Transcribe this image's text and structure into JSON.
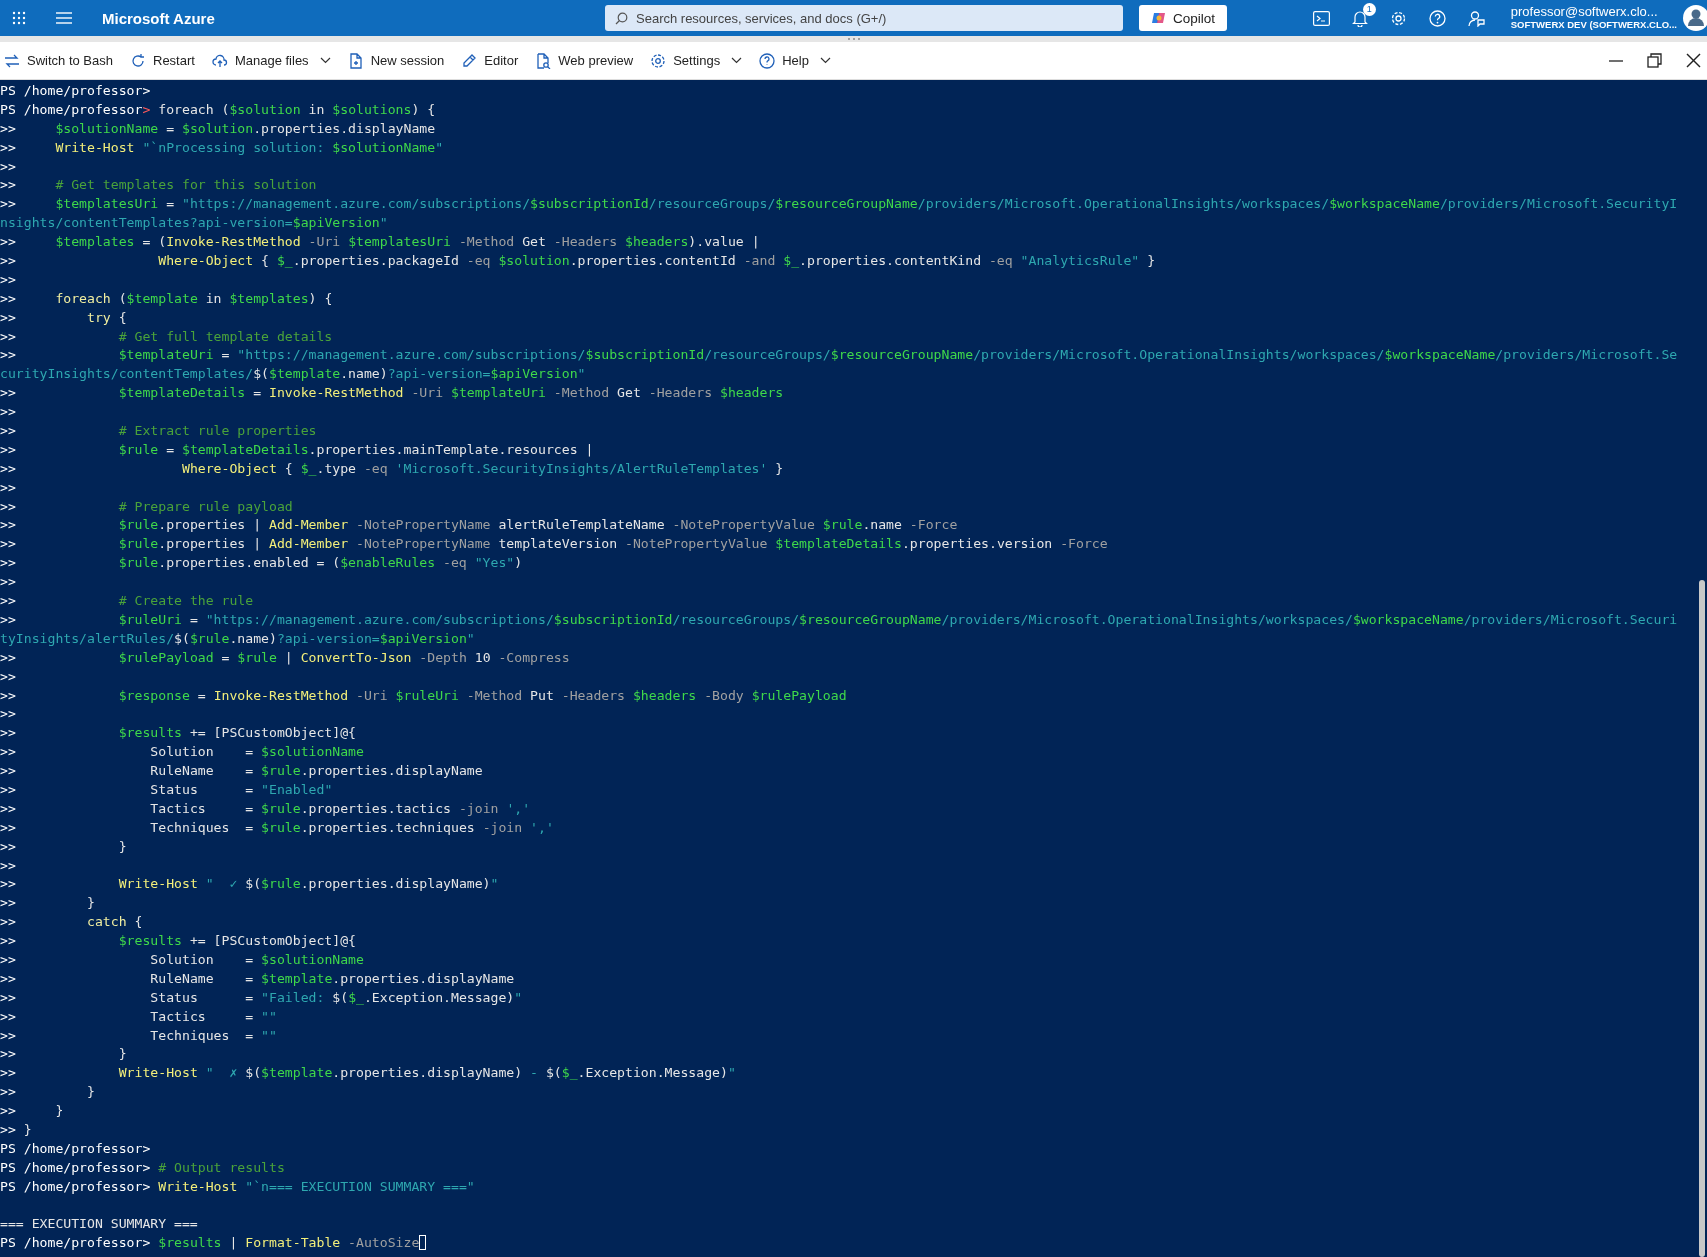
{
  "top_bar": {
    "brand": "Microsoft Azure",
    "search": {
      "placeholder": "Search resources, services, and docs (G+/)"
    },
    "copilot": "Copilot",
    "notification_count": "1",
    "user": {
      "email": "professor@softwerx.clo...",
      "directory": "SOFTWERX DEV (SOFTWERX.CLO..."
    }
  },
  "toolbar": {
    "items": [
      {
        "kind": "switch",
        "label": "Switch to Bash",
        "dropdown": false
      },
      {
        "kind": "restart",
        "label": "Restart",
        "dropdown": false
      },
      {
        "kind": "files",
        "label": "Manage files",
        "dropdown": true
      },
      {
        "kind": "session",
        "label": "New session",
        "dropdown": false
      },
      {
        "kind": "editor",
        "label": "Editor",
        "dropdown": false
      },
      {
        "kind": "preview",
        "label": "Web preview",
        "dropdown": false
      },
      {
        "kind": "settings",
        "label": "Settings",
        "dropdown": true
      },
      {
        "kind": "help",
        "label": "Help",
        "dropdown": true
      }
    ]
  },
  "terminal": {
    "lines": [
      {
        "segments": [
          {
            "kind": "prompt",
            "text": "PS /home/professor>"
          }
        ]
      },
      {
        "segments": [
          {
            "kind": "prompt",
            "text": "PS /home/professor"
          },
          {
            "kind": "error",
            "text": ">"
          },
          {
            "kind": "plain",
            "text": " foreach ("
          },
          {
            "kind": "var",
            "text": "$solution"
          },
          {
            "kind": "plain",
            "text": " in "
          },
          {
            "kind": "var",
            "text": "$solutions"
          },
          {
            "kind": "plain",
            "text": ") {"
          }
        ]
      },
      {
        "segments": [
          {
            "kind": "prompt",
            "text": ">>"
          },
          {
            "kind": "var",
            "text": "     $solutionName"
          },
          {
            "kind": "plain",
            "text": " = "
          },
          {
            "kind": "var",
            "text": "$solution"
          },
          {
            "kind": "plain",
            "text": ".properties.displayName"
          }
        ]
      },
      {
        "segments": [
          {
            "kind": "prompt",
            "text": ">>"
          },
          {
            "kind": "cmd",
            "text": "     Write-Host"
          },
          {
            "kind": "str",
            "text": " \"`nProcessing solution: "
          },
          {
            "kind": "var",
            "text": "$solutionName"
          },
          {
            "kind": "str",
            "text": "\""
          }
        ]
      },
      {
        "segments": [
          {
            "kind": "prompt",
            "text": ">>"
          }
        ]
      },
      {
        "segments": [
          {
            "kind": "prompt",
            "text": ">>"
          },
          {
            "kind": "comment",
            "text": "     # Get templates for this solution"
          }
        ]
      },
      {
        "segments": [
          {
            "kind": "prompt",
            "text": ">>"
          },
          {
            "kind": "var",
            "text": "     $templatesUri"
          },
          {
            "kind": "plain",
            "text": " = "
          },
          {
            "kind": "str",
            "text": "\"https://management.azure.com/subscriptions/"
          },
          {
            "kind": "var",
            "text": "$subscriptionId"
          },
          {
            "kind": "str",
            "text": "/resourceGroups/"
          },
          {
            "kind": "var",
            "text": "$resourceGroupName"
          },
          {
            "kind": "str",
            "text": "/providers/Microsoft.OperationalInsights/workspaces/"
          },
          {
            "kind": "var",
            "text": "$workspaceName"
          },
          {
            "kind": "str",
            "text": "/providers/Microsoft.SecurityI"
          }
        ]
      },
      {
        "segments": [
          {
            "kind": "str",
            "text": "nsights/contentTemplates?api-version="
          },
          {
            "kind": "var",
            "text": "$apiVersion"
          },
          {
            "kind": "str",
            "text": "\""
          }
        ]
      },
      {
        "segments": [
          {
            "kind": "prompt",
            "text": ">>"
          },
          {
            "kind": "var",
            "text": "     $templates"
          },
          {
            "kind": "plain",
            "text": " = ("
          },
          {
            "kind": "cmd",
            "text": "Invoke-RestMethod"
          },
          {
            "kind": "param",
            "text": " -Uri "
          },
          {
            "kind": "var",
            "text": "$templatesUri"
          },
          {
            "kind": "param",
            "text": " -Method "
          },
          {
            "kind": "plain",
            "text": "Get"
          },
          {
            "kind": "param",
            "text": " -Headers "
          },
          {
            "kind": "var",
            "text": "$headers"
          },
          {
            "kind": "plain",
            "text": ").value |"
          }
        ]
      },
      {
        "segments": [
          {
            "kind": "prompt",
            "text": ">>"
          },
          {
            "kind": "cmd",
            "text": "                  Where-Object"
          },
          {
            "kind": "plain",
            "text": " { "
          },
          {
            "kind": "var",
            "text": "$_"
          },
          {
            "kind": "plain",
            "text": ".properties.packageId"
          },
          {
            "kind": "param",
            "text": " -eq "
          },
          {
            "kind": "var",
            "text": "$solution"
          },
          {
            "kind": "plain",
            "text": ".properties.contentId"
          },
          {
            "kind": "param",
            "text": " -and "
          },
          {
            "kind": "var",
            "text": "$_"
          },
          {
            "kind": "plain",
            "text": ".properties.contentKind"
          },
          {
            "kind": "param",
            "text": " -eq "
          },
          {
            "kind": "str",
            "text": "\"AnalyticsRule\""
          },
          {
            "kind": "plain",
            "text": " }"
          }
        ]
      },
      {
        "segments": [
          {
            "kind": "prompt",
            "text": ">>"
          }
        ]
      },
      {
        "segments": [
          {
            "kind": "prompt",
            "text": ">>"
          },
          {
            "kind": "kw",
            "text": "     foreach"
          },
          {
            "kind": "plain",
            "text": " ("
          },
          {
            "kind": "var",
            "text": "$template"
          },
          {
            "kind": "plain",
            "text": " in "
          },
          {
            "kind": "var",
            "text": "$templates"
          },
          {
            "kind": "plain",
            "text": ") {"
          }
        ]
      },
      {
        "segments": [
          {
            "kind": "prompt",
            "text": ">>"
          },
          {
            "kind": "kw",
            "text": "         try"
          },
          {
            "kind": "plain",
            "text": " {"
          }
        ]
      },
      {
        "segments": [
          {
            "kind": "prompt",
            "text": ">>"
          },
          {
            "kind": "comment",
            "text": "             # Get full template details"
          }
        ]
      },
      {
        "segments": [
          {
            "kind": "prompt",
            "text": ">>"
          },
          {
            "kind": "var",
            "text": "             $templateUri"
          },
          {
            "kind": "plain",
            "text": " = "
          },
          {
            "kind": "str",
            "text": "\"https://management.azure.com/subscriptions/"
          },
          {
            "kind": "var",
            "text": "$subscriptionId"
          },
          {
            "kind": "str",
            "text": "/resourceGroups/"
          },
          {
            "kind": "var",
            "text": "$resourceGroupName"
          },
          {
            "kind": "str",
            "text": "/providers/Microsoft.OperationalInsights/workspaces/"
          },
          {
            "kind": "var",
            "text": "$workspaceName"
          },
          {
            "kind": "str",
            "text": "/providers/Microsoft.Se"
          }
        ]
      },
      {
        "segments": [
          {
            "kind": "str",
            "text": "curityInsights/contentTemplates/"
          },
          {
            "kind": "plain",
            "text": "$("
          },
          {
            "kind": "var",
            "text": "$template"
          },
          {
            "kind": "plain",
            "text": ".name)"
          },
          {
            "kind": "str",
            "text": "?api-version="
          },
          {
            "kind": "var",
            "text": "$apiVersion"
          },
          {
            "kind": "str",
            "text": "\""
          }
        ]
      },
      {
        "segments": [
          {
            "kind": "prompt",
            "text": ">>"
          },
          {
            "kind": "var",
            "text": "             $templateDetails"
          },
          {
            "kind": "plain",
            "text": " = "
          },
          {
            "kind": "cmd",
            "text": "Invoke-RestMethod"
          },
          {
            "kind": "param",
            "text": " -Uri "
          },
          {
            "kind": "var",
            "text": "$templateUri"
          },
          {
            "kind": "param",
            "text": " -Method "
          },
          {
            "kind": "plain",
            "text": "Get"
          },
          {
            "kind": "param",
            "text": " -Headers "
          },
          {
            "kind": "var",
            "text": "$headers"
          }
        ]
      },
      {
        "segments": [
          {
            "kind": "prompt",
            "text": ">>"
          }
        ]
      },
      {
        "segments": [
          {
            "kind": "prompt",
            "text": ">>"
          },
          {
            "kind": "comment",
            "text": "             # Extract rule properties"
          }
        ]
      },
      {
        "segments": [
          {
            "kind": "prompt",
            "text": ">>"
          },
          {
            "kind": "var",
            "text": "             $rule"
          },
          {
            "kind": "plain",
            "text": " = "
          },
          {
            "kind": "var",
            "text": "$templateDetails"
          },
          {
            "kind": "plain",
            "text": ".properties.mainTemplate.resources |"
          }
        ]
      },
      {
        "segments": [
          {
            "kind": "prompt",
            "text": ">>"
          },
          {
            "kind": "cmd",
            "text": "                     Where-Object"
          },
          {
            "kind": "plain",
            "text": " { "
          },
          {
            "kind": "var",
            "text": "$_"
          },
          {
            "kind": "plain",
            "text": ".type"
          },
          {
            "kind": "param",
            "text": " -eq "
          },
          {
            "kind": "str",
            "text": "'Microsoft.SecurityInsights/AlertRuleTemplates'"
          },
          {
            "kind": "plain",
            "text": " }"
          }
        ]
      },
      {
        "segments": [
          {
            "kind": "prompt",
            "text": ">>"
          }
        ]
      },
      {
        "segments": [
          {
            "kind": "prompt",
            "text": ">>"
          },
          {
            "kind": "comment",
            "text": "             # Prepare rule payload"
          }
        ]
      },
      {
        "segments": [
          {
            "kind": "prompt",
            "text": ">>"
          },
          {
            "kind": "var",
            "text": "             $rule"
          },
          {
            "kind": "plain",
            "text": ".properties | "
          },
          {
            "kind": "cmd",
            "text": "Add-Member"
          },
          {
            "kind": "param",
            "text": " -NotePropertyName "
          },
          {
            "kind": "plain",
            "text": "alertRuleTemplateName"
          },
          {
            "kind": "param",
            "text": " -NotePropertyValue "
          },
          {
            "kind": "var",
            "text": "$rule"
          },
          {
            "kind": "plain",
            "text": ".name"
          },
          {
            "kind": "param",
            "text": " -Force"
          }
        ]
      },
      {
        "segments": [
          {
            "kind": "prompt",
            "text": ">>"
          },
          {
            "kind": "var",
            "text": "             $rule"
          },
          {
            "kind": "plain",
            "text": ".properties | "
          },
          {
            "kind": "cmd",
            "text": "Add-Member"
          },
          {
            "kind": "param",
            "text": " -NotePropertyName "
          },
          {
            "kind": "plain",
            "text": "templateVersion"
          },
          {
            "kind": "param",
            "text": " -NotePropertyValue "
          },
          {
            "kind": "var",
            "text": "$templateDetails"
          },
          {
            "kind": "plain",
            "text": ".properties.version"
          },
          {
            "kind": "param",
            "text": " -Force"
          }
        ]
      },
      {
        "segments": [
          {
            "kind": "prompt",
            "text": ">>"
          },
          {
            "kind": "var",
            "text": "             $rule"
          },
          {
            "kind": "plain",
            "text": ".properties.enabled = ("
          },
          {
            "kind": "var",
            "text": "$enableRules"
          },
          {
            "kind": "param",
            "text": " -eq "
          },
          {
            "kind": "str",
            "text": "\"Yes\""
          },
          {
            "kind": "plain",
            "text": ")"
          }
        ]
      },
      {
        "segments": [
          {
            "kind": "prompt",
            "text": ">>"
          }
        ]
      },
      {
        "segments": [
          {
            "kind": "prompt",
            "text": ">>"
          },
          {
            "kind": "comment",
            "text": "             # Create the rule"
          }
        ]
      },
      {
        "segments": [
          {
            "kind": "prompt",
            "text": ">>"
          },
          {
            "kind": "var",
            "text": "             $ruleUri"
          },
          {
            "kind": "plain",
            "text": " = "
          },
          {
            "kind": "str",
            "text": "\"https://management.azure.com/subscriptions/"
          },
          {
            "kind": "var",
            "text": "$subscriptionId"
          },
          {
            "kind": "str",
            "text": "/resourceGroups/"
          },
          {
            "kind": "var",
            "text": "$resourceGroupName"
          },
          {
            "kind": "str",
            "text": "/providers/Microsoft.OperationalInsights/workspaces/"
          },
          {
            "kind": "var",
            "text": "$workspaceName"
          },
          {
            "kind": "str",
            "text": "/providers/Microsoft.Securi"
          }
        ]
      },
      {
        "segments": [
          {
            "kind": "str",
            "text": "tyInsights/alertRules/"
          },
          {
            "kind": "plain",
            "text": "$("
          },
          {
            "kind": "var",
            "text": "$rule"
          },
          {
            "kind": "plain",
            "text": ".name)"
          },
          {
            "kind": "str",
            "text": "?api-version="
          },
          {
            "kind": "var",
            "text": "$apiVersion"
          },
          {
            "kind": "str",
            "text": "\""
          }
        ]
      },
      {
        "segments": [
          {
            "kind": "prompt",
            "text": ">>"
          },
          {
            "kind": "var",
            "text": "             $rulePayload"
          },
          {
            "kind": "plain",
            "text": " = "
          },
          {
            "kind": "var",
            "text": "$rule"
          },
          {
            "kind": "plain",
            "text": " | "
          },
          {
            "kind": "cmd",
            "text": "ConvertTo-Json"
          },
          {
            "kind": "param",
            "text": " -Depth "
          },
          {
            "kind": "plain",
            "text": "10"
          },
          {
            "kind": "param",
            "text": " -Compress"
          }
        ]
      },
      {
        "segments": [
          {
            "kind": "prompt",
            "text": ">>"
          }
        ]
      },
      {
        "segments": [
          {
            "kind": "prompt",
            "text": ">>"
          },
          {
            "kind": "var",
            "text": "             $response"
          },
          {
            "kind": "plain",
            "text": " = "
          },
          {
            "kind": "cmd",
            "text": "Invoke-RestMethod"
          },
          {
            "kind": "param",
            "text": " -Uri "
          },
          {
            "kind": "var",
            "text": "$ruleUri"
          },
          {
            "kind": "param",
            "text": " -Method "
          },
          {
            "kind": "plain",
            "text": "Put"
          },
          {
            "kind": "param",
            "text": " -Headers "
          },
          {
            "kind": "var",
            "text": "$headers"
          },
          {
            "kind": "param",
            "text": " -Body "
          },
          {
            "kind": "var",
            "text": "$rulePayload"
          }
        ]
      },
      {
        "segments": [
          {
            "kind": "prompt",
            "text": ">>"
          }
        ]
      },
      {
        "segments": [
          {
            "kind": "prompt",
            "text": ">>"
          },
          {
            "kind": "var",
            "text": "             $results"
          },
          {
            "kind": "plain",
            "text": " += [PSCustomObject]@{"
          }
        ]
      },
      {
        "segments": [
          {
            "kind": "prompt",
            "text": ">>"
          },
          {
            "kind": "plain",
            "text": "                 Solution    = "
          },
          {
            "kind": "var",
            "text": "$solutionName"
          }
        ]
      },
      {
        "segments": [
          {
            "kind": "prompt",
            "text": ">>"
          },
          {
            "kind": "plain",
            "text": "                 RuleName    = "
          },
          {
            "kind": "var",
            "text": "$rule"
          },
          {
            "kind": "plain",
            "text": ".properties.displayName"
          }
        ]
      },
      {
        "segments": [
          {
            "kind": "prompt",
            "text": ">>"
          },
          {
            "kind": "plain",
            "text": "                 Status      = "
          },
          {
            "kind": "str",
            "text": "\"Enabled\""
          }
        ]
      },
      {
        "segments": [
          {
            "kind": "prompt",
            "text": ">>"
          },
          {
            "kind": "plain",
            "text": "                 Tactics     = "
          },
          {
            "kind": "var",
            "text": "$rule"
          },
          {
            "kind": "plain",
            "text": ".properties.tactics"
          },
          {
            "kind": "param",
            "text": " -join "
          },
          {
            "kind": "str",
            "text": "','"
          }
        ]
      },
      {
        "segments": [
          {
            "kind": "prompt",
            "text": ">>"
          },
          {
            "kind": "plain",
            "text": "                 Techniques  = "
          },
          {
            "kind": "var",
            "text": "$rule"
          },
          {
            "kind": "plain",
            "text": ".properties.techniques"
          },
          {
            "kind": "param",
            "text": " -join "
          },
          {
            "kind": "str",
            "text": "','"
          }
        ]
      },
      {
        "segments": [
          {
            "kind": "prompt",
            "text": ">>"
          },
          {
            "kind": "plain",
            "text": "             }"
          }
        ]
      },
      {
        "segments": [
          {
            "kind": "prompt",
            "text": ">>"
          }
        ]
      },
      {
        "segments": [
          {
            "kind": "prompt",
            "text": ">>"
          },
          {
            "kind": "cmd",
            "text": "             Write-Host"
          },
          {
            "kind": "str",
            "text": " \"  ✓ "
          },
          {
            "kind": "plain",
            "text": "$("
          },
          {
            "kind": "var",
            "text": "$rule"
          },
          {
            "kind": "plain",
            "text": ".properties.displayName)"
          },
          {
            "kind": "str",
            "text": "\""
          }
        ]
      },
      {
        "segments": [
          {
            "kind": "prompt",
            "text": ">>"
          },
          {
            "kind": "plain",
            "text": "         }"
          }
        ]
      },
      {
        "segments": [
          {
            "kind": "prompt",
            "text": ">>"
          },
          {
            "kind": "kw",
            "text": "         catch"
          },
          {
            "kind": "plain",
            "text": " {"
          }
        ]
      },
      {
        "segments": [
          {
            "kind": "prompt",
            "text": ">>"
          },
          {
            "kind": "var",
            "text": "             $results"
          },
          {
            "kind": "plain",
            "text": " += [PSCustomObject]@{"
          }
        ]
      },
      {
        "segments": [
          {
            "kind": "prompt",
            "text": ">>"
          },
          {
            "kind": "plain",
            "text": "                 Solution    = "
          },
          {
            "kind": "var",
            "text": "$solutionName"
          }
        ]
      },
      {
        "segments": [
          {
            "kind": "prompt",
            "text": ">>"
          },
          {
            "kind": "plain",
            "text": "                 RuleName    = "
          },
          {
            "kind": "var",
            "text": "$template"
          },
          {
            "kind": "plain",
            "text": ".properties.displayName"
          }
        ]
      },
      {
        "segments": [
          {
            "kind": "prompt",
            "text": ">>"
          },
          {
            "kind": "plain",
            "text": "                 Status      = "
          },
          {
            "kind": "str",
            "text": "\"Failed: "
          },
          {
            "kind": "plain",
            "text": "$("
          },
          {
            "kind": "var",
            "text": "$_"
          },
          {
            "kind": "plain",
            "text": ".Exception.Message)"
          },
          {
            "kind": "str",
            "text": "\""
          }
        ]
      },
      {
        "segments": [
          {
            "kind": "prompt",
            "text": ">>"
          },
          {
            "kind": "plain",
            "text": "                 Tactics     = "
          },
          {
            "kind": "str",
            "text": "\"\""
          }
        ]
      },
      {
        "segments": [
          {
            "kind": "prompt",
            "text": ">>"
          },
          {
            "kind": "plain",
            "text": "                 Techniques  = "
          },
          {
            "kind": "str",
            "text": "\"\""
          }
        ]
      },
      {
        "segments": [
          {
            "kind": "prompt",
            "text": ">>"
          },
          {
            "kind": "plain",
            "text": "             }"
          }
        ]
      },
      {
        "segments": [
          {
            "kind": "prompt",
            "text": ">>"
          },
          {
            "kind": "cmd",
            "text": "             Write-Host"
          },
          {
            "kind": "str",
            "text": " \"  ✗ "
          },
          {
            "kind": "plain",
            "text": "$("
          },
          {
            "kind": "var",
            "text": "$template"
          },
          {
            "kind": "plain",
            "text": ".properties.displayName)"
          },
          {
            "kind": "str",
            "text": " - "
          },
          {
            "kind": "plain",
            "text": "$("
          },
          {
            "kind": "var",
            "text": "$_"
          },
          {
            "kind": "plain",
            "text": ".Exception.Message)"
          },
          {
            "kind": "str",
            "text": "\""
          }
        ]
      },
      {
        "segments": [
          {
            "kind": "prompt",
            "text": ">>"
          },
          {
            "kind": "plain",
            "text": "         }"
          }
        ]
      },
      {
        "segments": [
          {
            "kind": "prompt",
            "text": ">>"
          },
          {
            "kind": "plain",
            "text": "     }"
          }
        ]
      },
      {
        "segments": [
          {
            "kind": "prompt",
            "text": ">>"
          },
          {
            "kind": "plain",
            "text": " }"
          }
        ]
      },
      {
        "segments": [
          {
            "kind": "prompt",
            "text": "PS /home/professor>"
          }
        ]
      },
      {
        "segments": [
          {
            "kind": "prompt",
            "text": "PS /home/professor>"
          },
          {
            "kind": "comment",
            "text": " # Output results"
          }
        ]
      },
      {
        "segments": [
          {
            "kind": "prompt",
            "text": "PS /home/professor>"
          },
          {
            "kind": "cmd",
            "text": " Write-Host"
          },
          {
            "kind": "str",
            "text": " \"`n=== EXECUTION SUMMARY ===\""
          }
        ]
      },
      {
        "kind": "blank"
      },
      {
        "segments": [
          {
            "kind": "plain",
            "text": "=== EXECUTION SUMMARY ==="
          }
        ]
      },
      {
        "segments": [
          {
            "kind": "prompt",
            "text": "PS /home/professor>"
          },
          {
            "kind": "var",
            "text": " $results"
          },
          {
            "kind": "plain",
            "text": " | "
          },
          {
            "kind": "cmd",
            "text": "Format-Table"
          },
          {
            "kind": "param",
            "text": " -AutoSize"
          }
        ],
        "cursor": true
      }
    ]
  }
}
